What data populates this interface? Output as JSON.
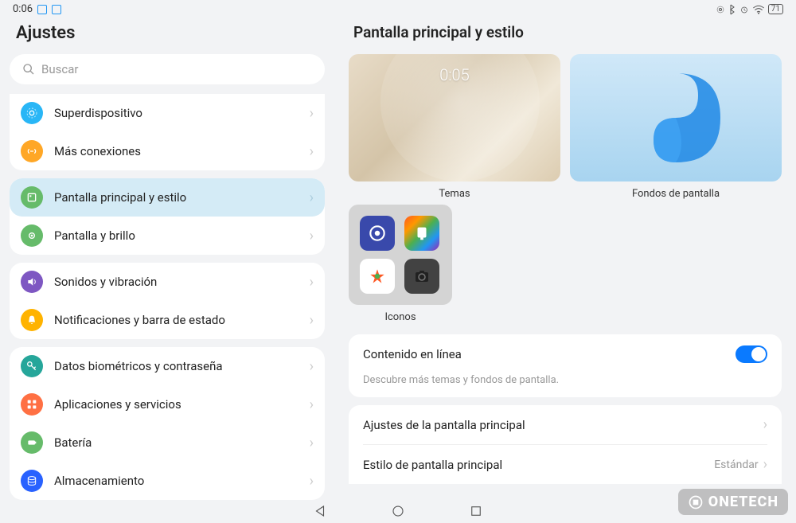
{
  "status": {
    "time": "0:06",
    "battery": "71"
  },
  "sidebar": {
    "title": "Ajustes",
    "search_placeholder": "Buscar",
    "group1": [
      {
        "label": "Superdispositivo",
        "color": "#29b6f6",
        "icon": "superdevice"
      },
      {
        "label": "Más conexiones",
        "color": "#ffa726",
        "icon": "link"
      }
    ],
    "group2": [
      {
        "label": "Pantalla principal y estilo",
        "color": "#66bb6a",
        "icon": "home",
        "selected": true
      },
      {
        "label": "Pantalla y brillo",
        "color": "#66bb6a",
        "icon": "brightness"
      }
    ],
    "group3": [
      {
        "label": "Sonidos y vibración",
        "color": "#7e57c2",
        "icon": "sound"
      },
      {
        "label": "Notificaciones y barra de estado",
        "color": "#ffb300",
        "icon": "bell"
      }
    ],
    "group4": [
      {
        "label": "Datos biométricos y contraseña",
        "color": "#26a69a",
        "icon": "key"
      },
      {
        "label": "Aplicaciones y servicios",
        "color": "#ff7043",
        "icon": "apps"
      },
      {
        "label": "Batería",
        "color": "#66bb6a",
        "icon": "battery"
      },
      {
        "label": "Almacenamiento",
        "color": "#2962ff",
        "icon": "storage"
      }
    ]
  },
  "main": {
    "title": "Pantalla principal y estilo",
    "tiles": {
      "themes": {
        "label": "Temas",
        "clock": "0:05"
      },
      "wallpapers": {
        "label": "Fondos de pantalla"
      },
      "icons": {
        "label": "Iconos"
      }
    },
    "online": {
      "title": "Contenido en línea",
      "enabled": true,
      "subtitle": "Descubre más temas y fondos de pantalla."
    },
    "rows": {
      "home_settings": "Ajustes de la pantalla principal",
      "home_style": {
        "label": "Estilo de pantalla principal",
        "value": "Estándar"
      }
    }
  },
  "watermark": "ONETECH"
}
